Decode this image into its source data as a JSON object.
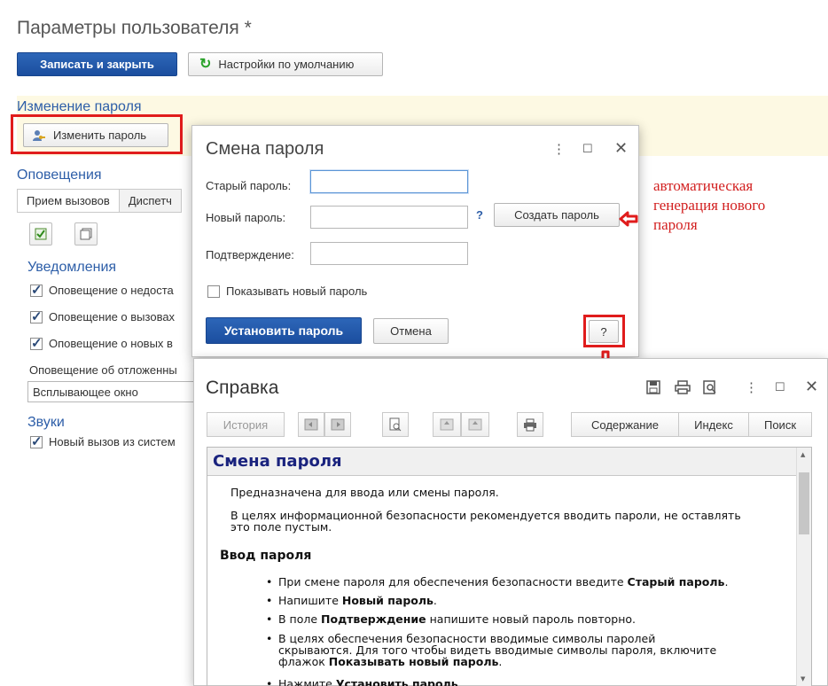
{
  "main": {
    "title": "Параметры пользователя *",
    "save_close_label": "Записать и закрыть",
    "defaults_label": "Настройки по умолчанию",
    "password_section_title": "Изменение пароля",
    "change_password_label": "Изменить пароль",
    "notifications_title": "Оповещения",
    "tabs": [
      {
        "label": "Прием вызовов"
      },
      {
        "label": "Диспетч"
      }
    ],
    "alerts_title": "Уведомления",
    "alerts": [
      {
        "label": "Оповещение о недоста",
        "checked": true
      },
      {
        "label": "Оповещение о вызовах",
        "checked": true
      },
      {
        "label": "Оповещение о новых в",
        "checked": true
      }
    ],
    "deferred_label": "Оповещение об отложенны",
    "deferred_value": "Всплывающее окно",
    "sounds_title": "Звуки",
    "sounds": [
      {
        "label": "Новый вызов из систем",
        "checked": true
      }
    ]
  },
  "dialog": {
    "title": "Смена пароля",
    "old_password_label": "Старый пароль:",
    "new_password_label": "Новый пароль:",
    "help_mark": "?",
    "generate_label": "Создать пароль",
    "confirm_label": "Подтверждение:",
    "show_password_label": "Показывать новый пароль",
    "set_password_label": "Установить пароль",
    "cancel_label": "Отмена",
    "help_button_label": "?"
  },
  "annotation": {
    "lines": [
      "автоматическая",
      "генерация нового",
      "пароля"
    ]
  },
  "help": {
    "title": "Справка",
    "history_label": "История",
    "contents_label": "Содержание",
    "index_label": "Индекс",
    "search_label": "Поиск",
    "heading": "Смена пароля",
    "intro": "Предназначена для ввода или смены пароля.",
    "security_line1": "В целях информационной безопасности рекомендуется вводить пароли, не оставлять",
    "security_line2": "это поле пустым.",
    "subheading": "Ввод пароля",
    "b1_text": "При смене пароля для обеспечения безопасности введите ",
    "b1_bold": "Старый пароль",
    "b1_end": ".",
    "b2_text": "Напишите ",
    "b2_bold": "Новый пароль",
    "b2_end": ".",
    "b3_text": "В поле ",
    "b3_bold": "Подтверждение",
    "b3_end": " напишите новый пароль повторно.",
    "b4_line1": "В целях обеспечения безопасности вводимые символы паролей",
    "b4_line2": "скрываются. Для того чтобы видеть вводимые символы пароля, включите",
    "b4_line3": "флажок ",
    "b4_bold": "Показывать новый пароль",
    "b4_end": ".",
    "b5_text": "Нажмите ",
    "b5_bold": "Установить пароль"
  },
  "colors": {
    "accent": "#1f56a8",
    "section_title": "#2d5ea8",
    "highlight_red": "#e01c1c",
    "info_background": "#fdf9e3"
  }
}
